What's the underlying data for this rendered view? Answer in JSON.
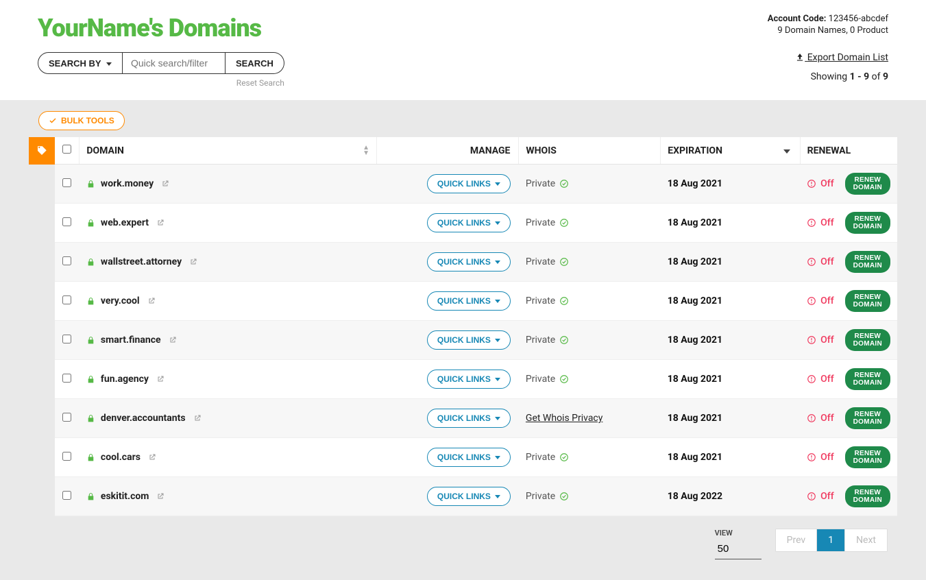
{
  "header": {
    "logo": "YourName's Domains",
    "account_code_label": "Account Code:",
    "account_code": "123456-abcdef",
    "summary": "9 Domain Names, 0 Product"
  },
  "search": {
    "by_label": "SEARCH BY",
    "placeholder": "Quick search/filter",
    "button": "SEARCH",
    "reset": "Reset Search"
  },
  "topright": {
    "export": "Export Domain List",
    "showing_prefix": "Showing ",
    "showing_range": "1 - 9",
    "showing_of": " of ",
    "showing_total": "9"
  },
  "toolbar": {
    "bulk_tools": "BULK TOOLS"
  },
  "columns": {
    "domain": "DOMAIN",
    "manage": "MANAGE",
    "whois": "WHOIS",
    "expiration": "EXPIRATION",
    "renewal": "RENEWAL"
  },
  "labels": {
    "quick_links": "QUICK LINKS",
    "private": "Private",
    "get_whois": "Get Whois Privacy",
    "off": "Off",
    "renew": "RENEW DOMAIN"
  },
  "rows": [
    {
      "name": "work.money",
      "whois": "private",
      "exp": "18 Aug 2021"
    },
    {
      "name": "web.expert",
      "whois": "private",
      "exp": "18 Aug 2021"
    },
    {
      "name": "wallstreet.attorney",
      "whois": "private",
      "exp": "18 Aug 2021"
    },
    {
      "name": "very.cool",
      "whois": "private",
      "exp": "18 Aug 2021"
    },
    {
      "name": "smart.finance",
      "whois": "private",
      "exp": "18 Aug 2021"
    },
    {
      "name": "fun.agency",
      "whois": "private",
      "exp": "18 Aug 2021"
    },
    {
      "name": "denver.accountants",
      "whois": "link",
      "exp": "18 Aug 2021"
    },
    {
      "name": "cool.cars",
      "whois": "private",
      "exp": "18 Aug 2021"
    },
    {
      "name": "eskitit.com",
      "whois": "private",
      "exp": "18 Aug 2022"
    }
  ],
  "footer": {
    "view_label": "VIEW",
    "view_value": "50",
    "prev": "Prev",
    "page": "1",
    "next": "Next"
  }
}
